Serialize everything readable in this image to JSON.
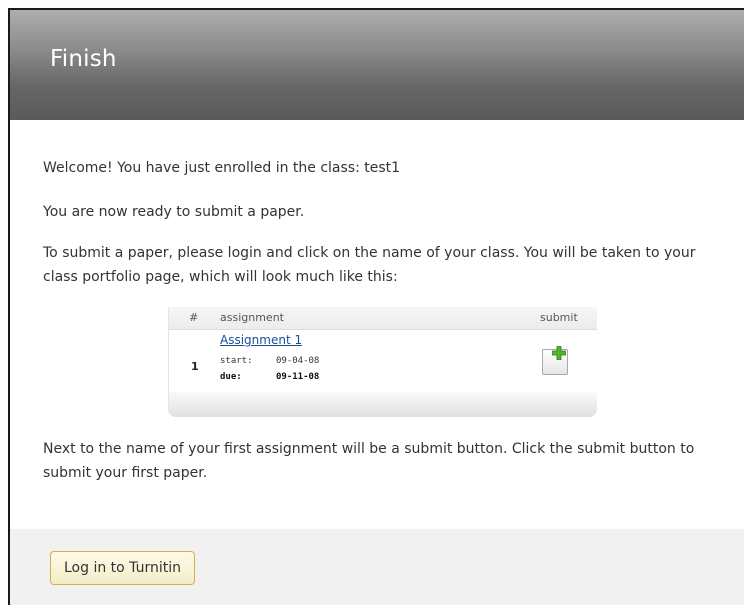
{
  "header": {
    "title": "Finish"
  },
  "content": {
    "welcome": "Welcome! You have just enrolled in the class: test1",
    "ready": "You are now ready to submit a paper.",
    "instructions": "To submit a paper, please login and click on the name of your class. You will be taken to your class portfolio page, which will look much like this:",
    "next": "Next to the name of your first assignment will be a submit button. Click the submit button to submit your first paper."
  },
  "portfolio_preview": {
    "columns": {
      "num": "#",
      "assignment": "assignment",
      "submit": "submit"
    },
    "row": {
      "num": "1",
      "assignment_name": "Assignment 1",
      "start_label": "start:",
      "start_value": "09-04-08",
      "due_label": "due:",
      "due_value": "09-11-08",
      "submit_icon": "add-document-icon"
    }
  },
  "footer": {
    "login_button": "Log in to Turnitin"
  },
  "colors": {
    "accent_border": "#d2b14a",
    "link": "#1a4f96",
    "plus_green": "#5cb030"
  }
}
